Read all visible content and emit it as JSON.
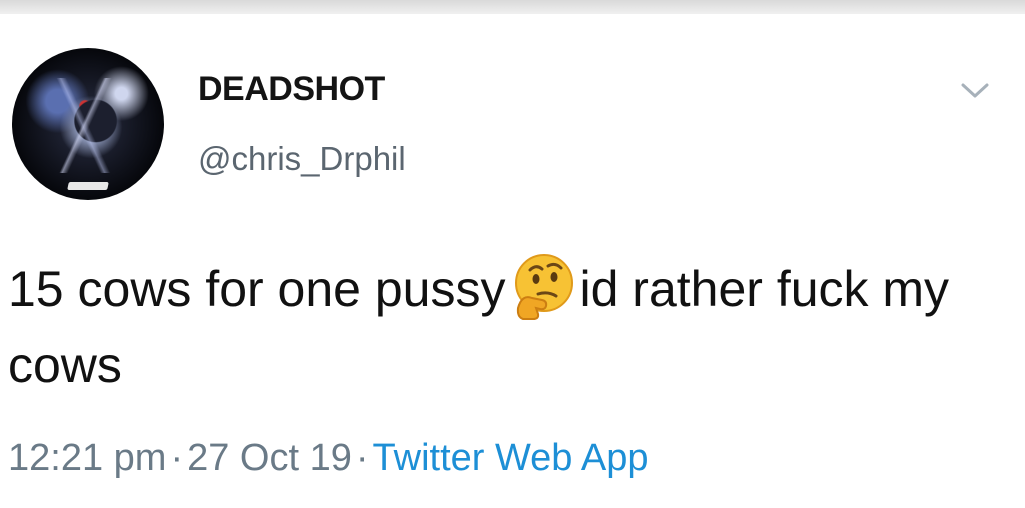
{
  "tweet": {
    "author": {
      "display_name": "DEADSHOT",
      "handle": "@chris_Drphil"
    },
    "text_part1": "15 cows for one pussy",
    "emoji_icon": "thinking-face-icon",
    "text_part2": "id rather fuck my cows",
    "meta": {
      "time": "12:21 pm",
      "separator": "·",
      "date": "27 Oct 19",
      "source": "Twitter Web App"
    },
    "colors": {
      "text": "#111111",
      "secondary": "#5b6670",
      "link": "#1d8fd6"
    }
  }
}
